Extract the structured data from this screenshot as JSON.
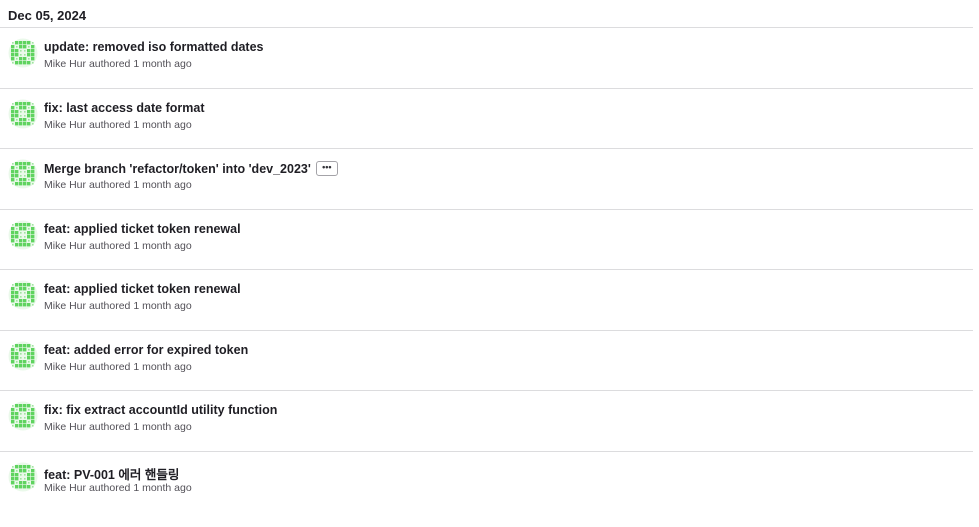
{
  "date_header": "Dec 05, 2024",
  "avatar_icon": "identicon-avatar-icon",
  "avatar_color": "#5fd35f",
  "ellipsis_label": "•••",
  "commits": [
    {
      "title": "update: removed iso formatted dates",
      "author": "Mike Hur",
      "action": "authored",
      "time": "1 month ago",
      "has_ellipsis": false
    },
    {
      "title": "fix: last access date format",
      "author": "Mike Hur",
      "action": "authored",
      "time": "1 month ago",
      "has_ellipsis": false
    },
    {
      "title": "Merge branch 'refactor/token' into 'dev_2023'",
      "author": "Mike Hur",
      "action": "authored",
      "time": "1 month ago",
      "has_ellipsis": true
    },
    {
      "title": "feat: applied ticket token renewal",
      "author": "Mike Hur",
      "action": "authored",
      "time": "1 month ago",
      "has_ellipsis": false
    },
    {
      "title": "feat: applied ticket token renewal",
      "author": "Mike Hur",
      "action": "authored",
      "time": "1 month ago",
      "has_ellipsis": false
    },
    {
      "title": "feat: added error for expired token",
      "author": "Mike Hur",
      "action": "authored",
      "time": "1 month ago",
      "has_ellipsis": false
    },
    {
      "title": "fix: fix extract accountId utility function",
      "author": "Mike Hur",
      "action": "authored",
      "time": "1 month ago",
      "has_ellipsis": false
    },
    {
      "title": "feat: PV-001 에러 핸들링",
      "author": "Mike Hur",
      "action": "authored",
      "time": "1 month ago",
      "has_ellipsis": false
    }
  ]
}
